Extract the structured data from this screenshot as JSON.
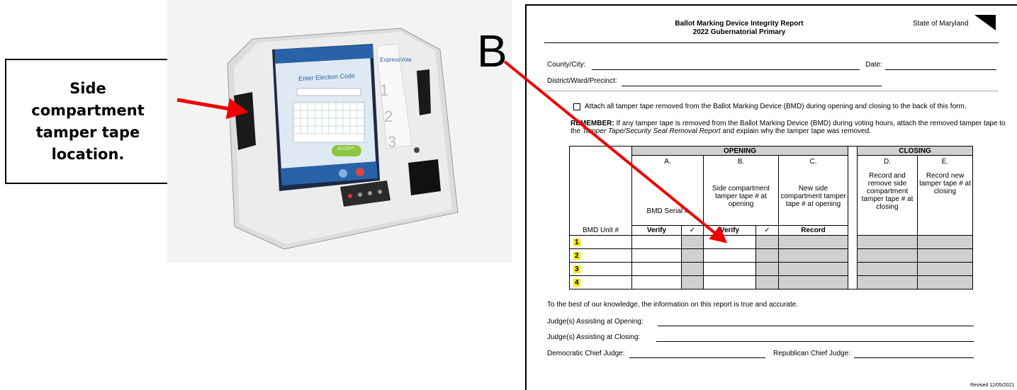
{
  "callout": {
    "text": "Side\ncompartment\ntamper tape\nlocation."
  },
  "device": {
    "brand": "ExpressVote",
    "screen_prompt": "Enter Election Code",
    "accept_button": "ACCEPT",
    "keyboard_rows": [
      [
        "1",
        "2",
        "3",
        "4",
        "5",
        "6",
        "7",
        "8",
        "9",
        "0"
      ],
      [
        "q",
        "w",
        "e",
        "r",
        "t",
        "y",
        "u",
        "i",
        "o",
        "p"
      ],
      [
        "a",
        "s",
        "d",
        "f",
        "g",
        "h",
        "j",
        "k",
        "l"
      ],
      [
        "z",
        "x",
        "c",
        "v",
        "b",
        "n",
        "m"
      ]
    ],
    "keyboard_bottom": [
      "Clear",
      "Space",
      "Backspace"
    ]
  },
  "annotation": {
    "letter": "B"
  },
  "form": {
    "title": "Ballot Marking Device Integrity Report",
    "subtitle": "2022 Gubernatorial Primary",
    "state": "State of Maryland",
    "county_label": "County/City:",
    "date_label": "Date:",
    "district_label": "District/Ward/Precinct:",
    "attach_text": "Attach all tamper tape removed from the Ballot Marking Device (BMD) during opening and closing to the back of this form.",
    "remember_label": "REMEMBER:",
    "remember_text_1": "If any tamper tape is removed from the Ballot Marking Device (BMD) during voting hours, attach the removed tamper tape to the",
    "remember_italic": "Tamper Tape/Security Seal Removal Report",
    "remember_text_2": "and explain why the tamper tape was removed.",
    "table": {
      "opening": "OPENING",
      "closing": "CLOSING",
      "col_letters": [
        "A.",
        "B.",
        "C.",
        "D.",
        "E."
      ],
      "col_desc": [
        "BMD Serial #",
        "Side compartment tamper tape # at opening",
        "New side compartment tamper tape # at opening",
        "Record and remove side compartment tamper tape # at closing",
        "Record new tamper tape # at closing"
      ],
      "unit_header": "BMD Unit #",
      "verify": "Verify",
      "check": "✓",
      "record": "Record",
      "units": [
        "1",
        "2",
        "3",
        "4"
      ]
    },
    "knowledge": "To the best of our knowledge, the information on this report is true and accurate.",
    "judges_opening": "Judge(s) Assisting at Opening:",
    "judges_closing": "Judge(s) Assisting at Closing:",
    "dem_judge": "Democratic Chief Judge:",
    "rep_judge": "Republican Chief Judge:",
    "revised": "Revised 12/05/2021"
  },
  "colors": {
    "arrow": "#ee0000",
    "highlight": "#ffe600",
    "shade": "#d0d0d0"
  }
}
